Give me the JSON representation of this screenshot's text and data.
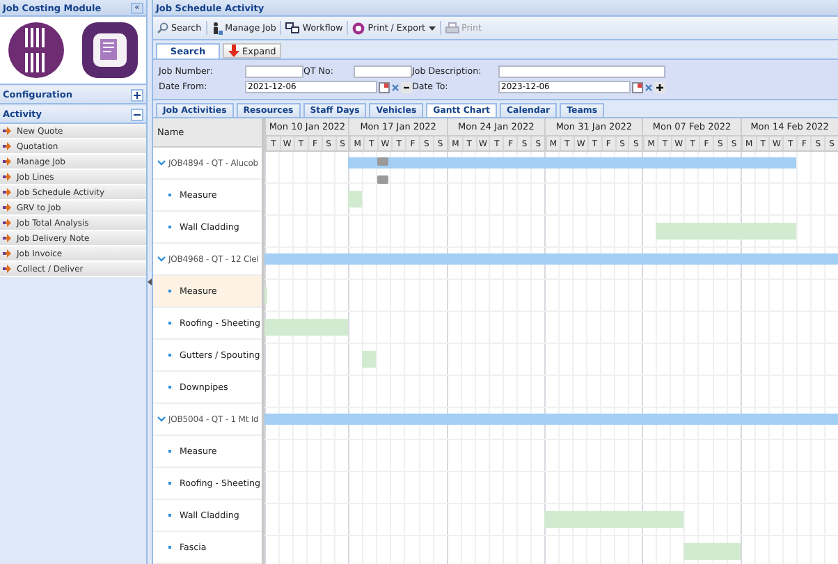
{
  "sidebar": {
    "title": "Job Costing Module",
    "collapse_button": "«",
    "sections": [
      {
        "label": "Configuration",
        "expanded": false
      },
      {
        "label": "Activity",
        "expanded": true,
        "items": [
          "New Quote",
          "Quotation",
          "Manage Job",
          "Job Lines",
          "Job Schedule Activity",
          "GRV to Job",
          "Job Total Analysis",
          "Job Delivery Note",
          "Job Invoice",
          "Collect / Deliver"
        ]
      }
    ]
  },
  "main": {
    "title": "Job Schedule Activity",
    "toolbar": [
      {
        "kind": "search",
        "label": "Search",
        "disabled": false,
        "dropdown": false
      },
      {
        "kind": "person",
        "label": "Manage Job",
        "disabled": false,
        "dropdown": false
      },
      {
        "kind": "workflow",
        "label": "Workflow",
        "disabled": false,
        "dropdown": false
      },
      {
        "kind": "export",
        "label": "Print / Export",
        "disabled": false,
        "dropdown": true
      },
      {
        "kind": "print",
        "label": "Print",
        "disabled": true,
        "dropdown": false
      }
    ],
    "search_bar": {
      "tab": "Search",
      "expand_button": "Expand"
    },
    "form": {
      "job_number": {
        "label": "Job Number:"
      },
      "qt_no": {
        "label": "QT No:"
      },
      "job_description": {
        "label": "Job Description:"
      },
      "date_from": {
        "label": "Date From:",
        "value": "2021-12-06"
      },
      "date_to": {
        "label": "Date To:",
        "value": "2023-12-06"
      }
    },
    "tabs": [
      {
        "label": "Job Activities",
        "selected": false
      },
      {
        "label": "Resources",
        "selected": false
      },
      {
        "label": "Staff Days",
        "selected": false
      },
      {
        "label": "Vehicles",
        "selected": false
      },
      {
        "label": "Gantt Chart",
        "selected": true
      },
      {
        "label": "Calendar",
        "selected": false
      },
      {
        "label": "Teams",
        "selected": false
      }
    ],
    "gantt": {
      "name_header": "Name",
      "weeks": [
        {
          "label": "Mon 10 Jan 2022",
          "days": [
            "T",
            "W",
            "T",
            "F",
            "S",
            "S"
          ]
        },
        {
          "label": "Mon 17 Jan 2022",
          "days": [
            "M",
            "T",
            "W",
            "T",
            "F",
            "S",
            "S"
          ]
        },
        {
          "label": "Mon 24 Jan 2022",
          "days": [
            "M",
            "T",
            "W",
            "T",
            "F",
            "S",
            "S"
          ]
        },
        {
          "label": "Mon 31 Jan 2022",
          "days": [
            "M",
            "T",
            "W",
            "T",
            "F",
            "S",
            "S"
          ]
        },
        {
          "label": "Mon 07 Feb 2022",
          "days": [
            "M",
            "T",
            "W",
            "T",
            "F",
            "S",
            "S"
          ]
        },
        {
          "label": "Mon 14 Feb 2022",
          "days": [
            "M",
            "T",
            "W",
            "T",
            "F",
            "S",
            "S"
          ]
        }
      ],
      "rows": [
        {
          "label": "JOB4894 - QT - Alucob",
          "expanded": true,
          "selected": false,
          "children": [
            {
              "label": "Measure",
              "selected": false
            },
            {
              "label": "Wall Cladding",
              "selected": false
            }
          ]
        },
        {
          "label": "JOB4968 - QT - 12 Clel",
          "expanded": true,
          "selected": false,
          "children": [
            {
              "label": "Measure",
              "selected": true
            },
            {
              "label": "Roofing - Sheeting",
              "selected": false
            },
            {
              "label": "Gutters / Spouting",
              "selected": false
            },
            {
              "label": "Downpipes",
              "selected": false
            }
          ]
        },
        {
          "label": "JOB5004 - QT - 1 Mt Id",
          "expanded": true,
          "selected": false,
          "children": [
            {
              "label": "Measure",
              "selected": false
            },
            {
              "label": "Roofing - Sheeting",
              "selected": false
            },
            {
              "label": "Wall Cladding",
              "selected": false
            },
            {
              "label": "Fascia",
              "selected": false
            }
          ]
        }
      ]
    }
  }
}
